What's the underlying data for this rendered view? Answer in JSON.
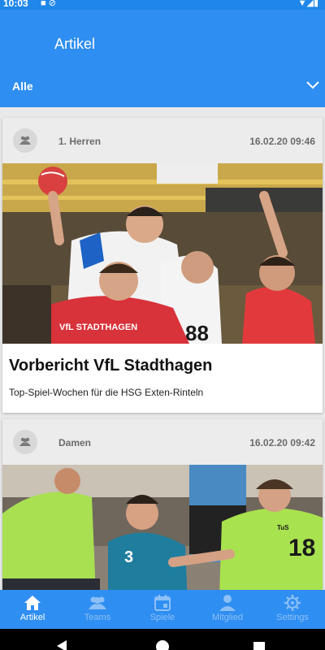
{
  "status_bar": {
    "time": "10:03"
  },
  "app_bar": {
    "title": "Artikel"
  },
  "filter": {
    "selected": "Alle"
  },
  "articles": [
    {
      "team": "1. Herren",
      "date": "16.02.20 09:46",
      "title": "Vorbericht VfL Stadthagen",
      "subtitle": "Top-Spiel-Wochen für die HSG Exten-Rinteln"
    },
    {
      "team": "Damen",
      "date": "16.02.20 09:42",
      "title": "",
      "subtitle": ""
    }
  ],
  "image_text": {
    "jersey_1": "VfL STADTHAGEN",
    "jersey_2": "TuS"
  },
  "bottom_nav": {
    "items": [
      {
        "label": "Artikel",
        "icon": "home-icon",
        "active": true
      },
      {
        "label": "Teams",
        "icon": "group-icon",
        "active": false
      },
      {
        "label": "Spiele",
        "icon": "calendar-icon",
        "active": false
      },
      {
        "label": "Mitglied",
        "icon": "person-icon",
        "active": false
      },
      {
        "label": "Settings",
        "icon": "gear-icon",
        "active": false
      }
    ]
  },
  "colors": {
    "primary": "#2f8ef1",
    "inactive_nav": "#8cc0f7",
    "card_header": "#ececec"
  }
}
